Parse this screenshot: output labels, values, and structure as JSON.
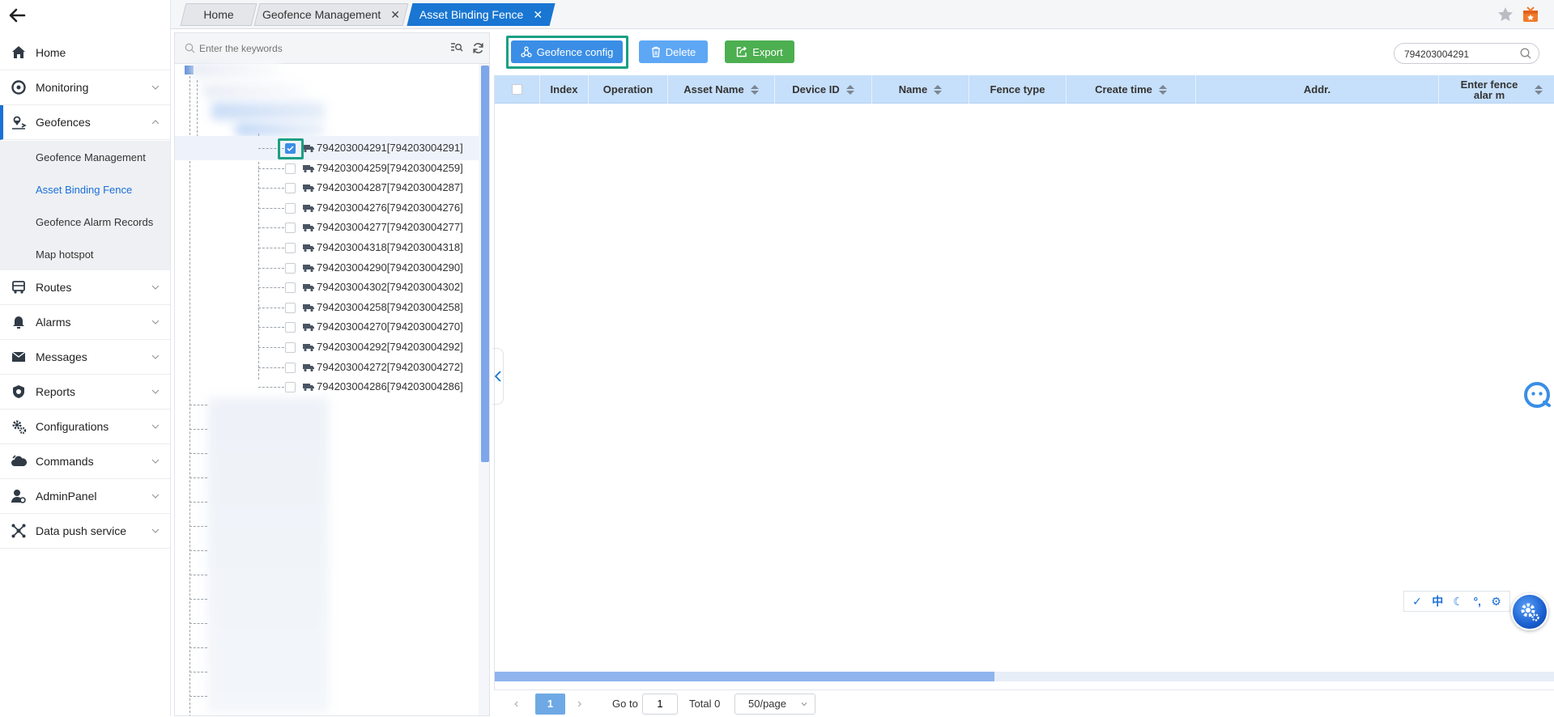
{
  "sidebar": {
    "items": [
      {
        "label": "Home",
        "icon": "home-icon"
      },
      {
        "label": "Monitoring",
        "icon": "monitor-icon"
      },
      {
        "label": "Geofences",
        "icon": "geofence-icon",
        "expanded": true
      },
      {
        "label": "Routes",
        "icon": "route-icon"
      },
      {
        "label": "Alarms",
        "icon": "alarm-icon"
      },
      {
        "label": "Messages",
        "icon": "mail-icon"
      },
      {
        "label": "Reports",
        "icon": "shield-icon"
      },
      {
        "label": "Configurations",
        "icon": "cog-icon"
      },
      {
        "label": "Commands",
        "icon": "cloud-icon"
      },
      {
        "label": "AdminPanel",
        "icon": "admin-icon"
      },
      {
        "label": "Data push service",
        "icon": "network-icon"
      }
    ],
    "subitems": [
      {
        "label": "Geofence Management"
      },
      {
        "label": "Asset Binding Fence",
        "selected": true
      },
      {
        "label": "Geofence Alarm Records"
      },
      {
        "label": "Map hotspot"
      }
    ]
  },
  "tabs": [
    {
      "label": "Home"
    },
    {
      "label": "Geofence Management",
      "closable": true
    },
    {
      "label": "Asset Binding Fence",
      "closable": true,
      "active": true
    }
  ],
  "tree": {
    "search_placeholder": "Enter the keywords",
    "devices": [
      {
        "label": "794203004291[794203004291]",
        "checked": true
      },
      {
        "label": "794203004259[794203004259]"
      },
      {
        "label": "794203004287[794203004287]"
      },
      {
        "label": "794203004276[794203004276]"
      },
      {
        "label": "794203004277[794203004277]"
      },
      {
        "label": "794203004318[794203004318]"
      },
      {
        "label": "794203004290[794203004290]"
      },
      {
        "label": "794203004302[794203004302]"
      },
      {
        "label": "794203004258[794203004258]"
      },
      {
        "label": "794203004270[794203004270]"
      },
      {
        "label": "794203004292[794203004292]"
      },
      {
        "label": "794203004272[794203004272]"
      },
      {
        "label": "794203004286[794203004286]"
      }
    ]
  },
  "toolbar": {
    "config_label": "Geofence config",
    "delete_label": "Delete",
    "export_label": "Export",
    "search_value": "794203004291"
  },
  "table": {
    "columns": [
      {
        "label": "Index"
      },
      {
        "label": "Operation"
      },
      {
        "label": "Asset Name",
        "sortable": true
      },
      {
        "label": "Device ID",
        "sortable": true
      },
      {
        "label": "Name",
        "sortable": true
      },
      {
        "label": "Fence type"
      },
      {
        "label": "Create time",
        "sortable": true
      },
      {
        "label": "Addr."
      },
      {
        "label": "Enter fence alar m",
        "sortable": true
      }
    ]
  },
  "pagination": {
    "current_page": "1",
    "goto_label": "Go to",
    "goto_value": "1",
    "total_label": "Total 0",
    "page_size": "50/page"
  },
  "tool_strip": [
    "✓",
    "中",
    "☾",
    "°,",
    "⚙"
  ],
  "colors": {
    "primary": "#1976d2",
    "export_green": "#4caf50",
    "highlight": "#1aa083",
    "table_header": "#c6dffa"
  }
}
